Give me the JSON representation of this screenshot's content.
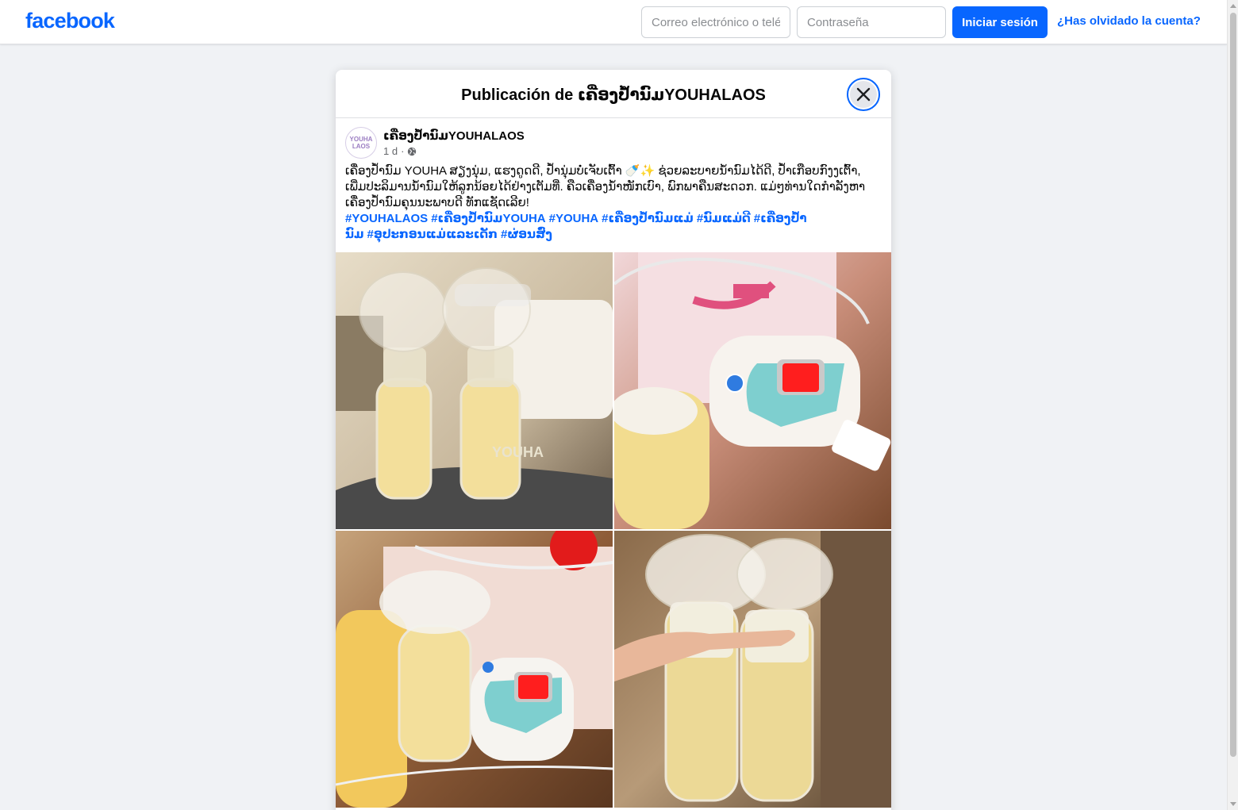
{
  "header": {
    "logo": "facebook",
    "email_placeholder": "Correo electrónico o teléfono",
    "password_placeholder": "Contraseña",
    "login_label": "Iniciar sesión",
    "forgot_label": "¿Has olvidado la cuenta?"
  },
  "modal": {
    "title": "Publicación de ເຄື່ອງປໍ້ານົມYOUHALAOS",
    "close_icon": "close-icon"
  },
  "post": {
    "author": "ເຄື່ອງປໍ້ານົມYOUHALAOS",
    "avatar_text": [
      "YOUHA",
      "LAOS"
    ],
    "time": "1 d",
    "privacy_icon": "globe-icon",
    "text": "ເຄື່ອງປໍ້ານົມ YOUHA ສຽງນຸ່ມ, ແຮງດູດດີ, ປໍ້ານຸ່ມບໍ່ເຈັບເຕົ້າ 🍼✨ ຊ່ວຍລະບາຍນ້ຳນົມໄດ້ດີ, ປໍ້າເກືອບກົງງເຕົ້າ, ເພີ່ມປະລິມານນ້ຳນົມໃຫ້ລູກນ້ອຍໄດ້ຢ່າງເຕັມທີ່. ຄືວເຄື່ອງນ້ຳໜັກເບົາ, ພົກພາຄືນສະດວກ. ແມ່ໆທ່ານໃດກຳລັງຫາເຄື່ອງປໍ້ານົມຄຸນນະພາບດີ ທັກແຊັດເລີຍ!",
    "hashtags": [
      "#YOUHALAOS",
      "#ເຄື່ອງປໍ້ານົມYOUHA",
      "#YOUHA",
      "#ເຄື່ອງປໍ້ານົມແມ່",
      "#ນົມແມ່ດີ",
      "#ເຄື່ອງປໍ້ານົມ",
      "#ອຸປະກອນແມ່ແລະເດັກ",
      "#ຜ່ອນສົ່ງ"
    ],
    "photos": [
      "photo-1",
      "photo-2",
      "photo-3",
      "photo-4"
    ],
    "device_brand": "YOUHA"
  },
  "colors": {
    "brand": "#0866ff",
    "page_bg": "#f0f2f5",
    "milk": "#f2dc8f"
  }
}
